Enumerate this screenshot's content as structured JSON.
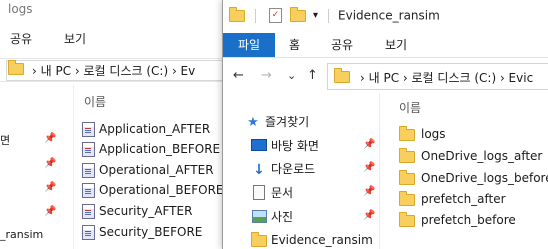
{
  "back_window": {
    "title": "logs",
    "ribbon_tabs": [
      "공유",
      "보기"
    ],
    "breadcrumb": "›  내 PC  ›  로컬 디스크 (C:)  ›  Ev",
    "column_header": "이름",
    "nav_fragments": [
      "면",
      "",
      "",
      "",
      "_ransim"
    ],
    "files": [
      "Application_AFTER",
      "Application_BEFORE",
      "Operational_AFTER",
      "Operational_BEFORE",
      "Security_AFTER",
      "Security_BEFORE"
    ]
  },
  "front_window": {
    "title": "Evidence_ransim",
    "quick_access_toggle": "▾",
    "ribbon": {
      "file_tab": "파일",
      "tabs": [
        "홈",
        "공유",
        "보기"
      ]
    },
    "nav_buttons": {
      "back": "←",
      "forward": "→",
      "recent": "⌄",
      "up": "↑"
    },
    "breadcrumb": "›  내 PC  ›  로컬 디스크 (C:)  ›  Evic",
    "nav_pane": [
      {
        "label": "즐겨찾기",
        "icon": "star-icon"
      },
      {
        "label": "바탕 화면",
        "icon": "desktop-icon"
      },
      {
        "label": "다운로드",
        "icon": "download-icon"
      },
      {
        "label": "문서",
        "icon": "document-icon"
      },
      {
        "label": "사진",
        "icon": "pictures-icon"
      },
      {
        "label": "Evidence_ransim",
        "icon": "folder-icon"
      }
    ],
    "column_header": "이름",
    "folders": [
      "logs",
      "OneDrive_logs_after",
      "OneDrive_logs_before",
      "prefetch_after",
      "prefetch_before"
    ]
  },
  "colors": {
    "accent": "#1a6fc9",
    "folder": "#f8cf5c"
  }
}
